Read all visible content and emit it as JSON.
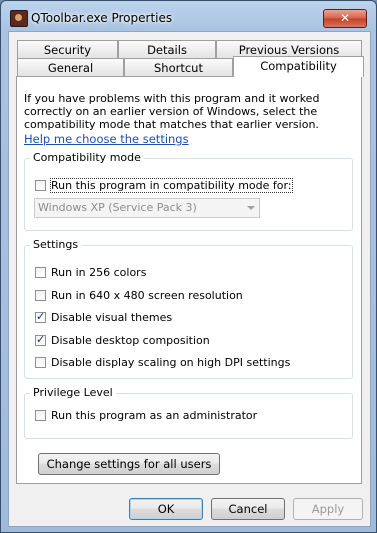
{
  "window": {
    "title": "QToolbar.exe Properties",
    "close_glyph": "✕"
  },
  "tabs": {
    "row1": [
      {
        "label": "Security"
      },
      {
        "label": "Details"
      },
      {
        "label": "Previous Versions"
      }
    ],
    "row2": [
      {
        "label": "General"
      },
      {
        "label": "Shortcut"
      },
      {
        "label": "Compatibility",
        "selected": true
      }
    ]
  },
  "compatibility": {
    "intro": "If you have problems with this program and it worked correctly on an earlier version of Windows, select the compatibility mode that matches that earlier version.",
    "help_link": "Help me choose the settings",
    "mode_group": {
      "title": "Compatibility mode",
      "checkbox_label": "Run this program in compatibility mode for:",
      "checked": false,
      "select_value": "Windows XP (Service Pack 3)"
    },
    "settings_group": {
      "title": "Settings",
      "items": [
        {
          "label": "Run in 256 colors",
          "checked": false
        },
        {
          "label": "Run in 640 x 480 screen resolution",
          "checked": false
        },
        {
          "label": "Disable visual themes",
          "checked": true
        },
        {
          "label": "Disable desktop composition",
          "checked": true
        },
        {
          "label": "Disable display scaling on high DPI settings",
          "checked": false
        }
      ]
    },
    "privilege_group": {
      "title": "Privilege Level",
      "checkbox_label": "Run this program as an administrator",
      "checked": false
    },
    "change_all_button": "Change settings for all users"
  },
  "footer": {
    "ok_label": "OK",
    "cancel_label": "Cancel",
    "apply_label": "Apply"
  },
  "colors": {
    "link": "#1b4fb3",
    "titlebar": "#a9c3e2",
    "close_button": "#c2412a"
  }
}
